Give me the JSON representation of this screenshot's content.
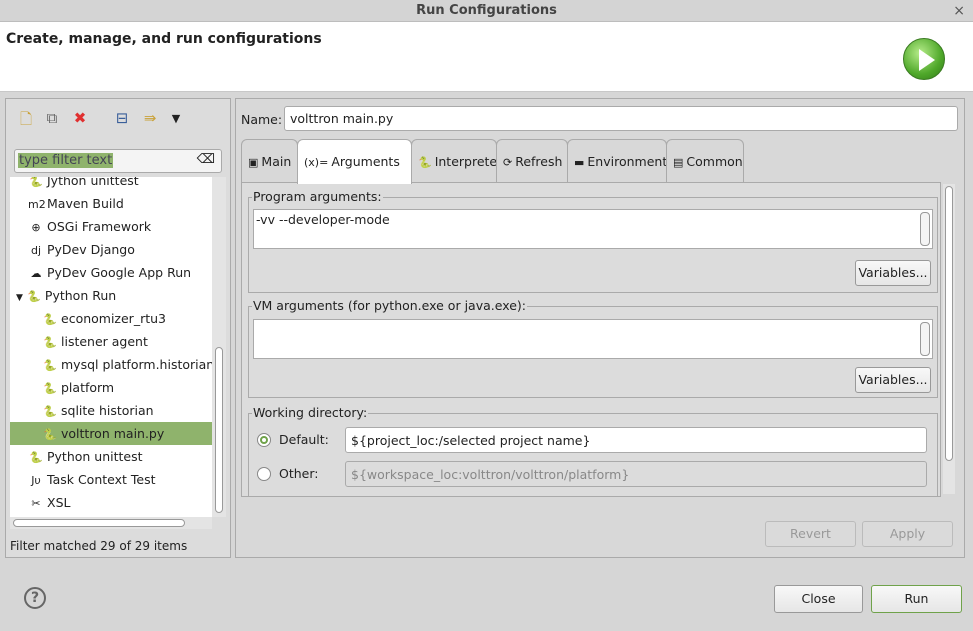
{
  "window": {
    "title": "Run Configurations",
    "close_icon": "×"
  },
  "header": {
    "title": "Create, manage, and run configurations"
  },
  "left": {
    "filter": {
      "placeholder": "type filter text"
    },
    "items": [
      {
        "label": "Jython unittest",
        "icon": "jython-icon",
        "glyph": "🐍",
        "indent": 1
      },
      {
        "label": "Maven Build",
        "icon": "maven-icon",
        "glyph": "m2",
        "indent": 1
      },
      {
        "label": "OSGi Framework",
        "icon": "osgi-icon",
        "glyph": "⊕",
        "indent": 1
      },
      {
        "label": "PyDev Django",
        "icon": "django-icon",
        "glyph": "dj",
        "indent": 1
      },
      {
        "label": "PyDev Google App Run",
        "icon": "google-app-icon",
        "glyph": "☁",
        "indent": 1
      },
      {
        "label": "Python Run",
        "icon": "python-icon",
        "glyph": "🐍",
        "indent": 1,
        "expanded": true
      },
      {
        "label": "economizer_rtu3",
        "icon": "python-icon",
        "glyph": "🐍",
        "indent": 2
      },
      {
        "label": "listener agent",
        "icon": "python-icon",
        "glyph": "🐍",
        "indent": 2
      },
      {
        "label": "mysql platform.historian",
        "icon": "python-icon",
        "glyph": "🐍",
        "indent": 2
      },
      {
        "label": "platform",
        "icon": "python-icon",
        "glyph": "🐍",
        "indent": 2
      },
      {
        "label": "sqlite historian",
        "icon": "python-icon",
        "glyph": "🐍",
        "indent": 2
      },
      {
        "label": "volttron main.py",
        "icon": "python-icon",
        "glyph": "🐍",
        "indent": 2,
        "selected": true
      },
      {
        "label": "Python unittest",
        "icon": "python-unittest-icon",
        "glyph": "🐍",
        "indent": 1
      },
      {
        "label": "Task Context Test",
        "icon": "junit-icon",
        "glyph": "Jυ",
        "indent": 1
      },
      {
        "label": "XSL",
        "icon": "xsl-icon",
        "glyph": "✂",
        "indent": 1
      }
    ],
    "status": "Filter matched 29 of 29 items"
  },
  "main": {
    "name_label": "Name:",
    "name_value": "volttron main.py",
    "tabs": [
      {
        "label": "Main",
        "icon": "main-tab-icon",
        "glyph": "▣"
      },
      {
        "label": "Arguments",
        "icon": "arguments-icon",
        "glyph": "(x)=",
        "active": true
      },
      {
        "label": "Interpreter",
        "icon": "python-icon",
        "glyph": "🐍"
      },
      {
        "label": "Refresh",
        "icon": "refresh-icon",
        "glyph": "⟳"
      },
      {
        "label": "Environment",
        "icon": "environment-icon",
        "glyph": "▬"
      },
      {
        "label": "Common",
        "icon": "common-icon",
        "glyph": "▤"
      }
    ],
    "program_args": {
      "label": "Program arguments:",
      "value": "-vv --developer-mode",
      "variables": "Variables..."
    },
    "vm_args": {
      "label": "VM arguments (for python.exe or java.exe):",
      "value": "",
      "variables": "Variables..."
    },
    "working_dir": {
      "label": "Working directory:",
      "default_label": "Default:",
      "default_value": "${project_loc:/selected project name}",
      "other_label": "Other:",
      "other_value": "${workspace_loc:volttron/volttron/platform}",
      "selected": "default"
    },
    "revert": "Revert",
    "apply": "Apply"
  },
  "footer": {
    "help": "?",
    "close": "Close",
    "run": "Run"
  }
}
